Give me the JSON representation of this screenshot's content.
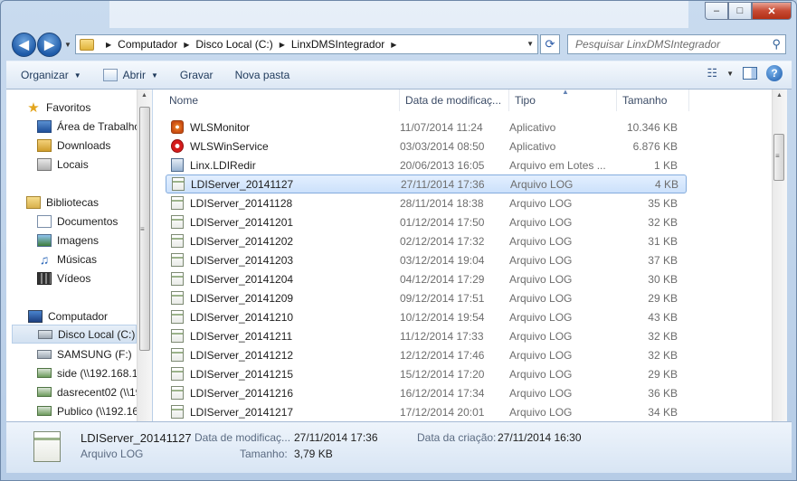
{
  "window": {
    "caption_minimize": "–",
    "caption_maximize": "□",
    "caption_close": "✕"
  },
  "address": {
    "crumbs": [
      "Computador",
      "Disco Local (C:)",
      "LinxDMSIntegrador"
    ]
  },
  "search": {
    "placeholder": "Pesquisar LinxDMSIntegrador"
  },
  "toolbar": {
    "organize": "Organizar",
    "open": "Abrir",
    "burn": "Gravar",
    "new_folder": "Nova pasta"
  },
  "nav": {
    "favorites": "Favoritos",
    "desktop": "Área de Trabalho",
    "downloads": "Downloads",
    "places": "Locais",
    "libraries": "Bibliotecas",
    "documents": "Documentos",
    "images": "Imagens",
    "music": "Músicas",
    "videos": "Vídeos",
    "computer": "Computador",
    "local_disk": "Disco Local (C:)",
    "samsung": "SAMSUNG (F:)",
    "side": "side (\\\\192.168.10",
    "dasrecent": "dasrecent02 (\\\\19",
    "publico": "Publico (\\\\192.16"
  },
  "columns": {
    "name": "Nome",
    "date": "Data de modificaç...",
    "type": "Tipo",
    "size": "Tamanho"
  },
  "files": [
    {
      "name": "WLSMonitor",
      "date": "11/07/2014 11:24",
      "type": "Aplicativo",
      "size": "10.346 KB",
      "icon": "wls-icon"
    },
    {
      "name": "WLSWinService",
      "date": "03/03/2014 08:50",
      "type": "Aplicativo",
      "size": "6.876 KB",
      "icon": "service-icon"
    },
    {
      "name": "Linx.LDIRedir",
      "date": "20/06/2013 16:05",
      "type": "Arquivo em Lotes ...",
      "size": "1 KB",
      "icon": "batch-file-icon"
    },
    {
      "name": "LDIServer_20141127",
      "date": "27/11/2014 17:36",
      "type": "Arquivo LOG",
      "size": "4 KB",
      "icon": "log-file-icon",
      "selected": true
    },
    {
      "name": "LDIServer_20141128",
      "date": "28/11/2014 18:38",
      "type": "Arquivo LOG",
      "size": "35 KB",
      "icon": "log-file-icon"
    },
    {
      "name": "LDIServer_20141201",
      "date": "01/12/2014 17:50",
      "type": "Arquivo LOG",
      "size": "32 KB",
      "icon": "log-file-icon"
    },
    {
      "name": "LDIServer_20141202",
      "date": "02/12/2014 17:32",
      "type": "Arquivo LOG",
      "size": "31 KB",
      "icon": "log-file-icon"
    },
    {
      "name": "LDIServer_20141203",
      "date": "03/12/2014 19:04",
      "type": "Arquivo LOG",
      "size": "37 KB",
      "icon": "log-file-icon"
    },
    {
      "name": "LDIServer_20141204",
      "date": "04/12/2014 17:29",
      "type": "Arquivo LOG",
      "size": "30 KB",
      "icon": "log-file-icon"
    },
    {
      "name": "LDIServer_20141209",
      "date": "09/12/2014 17:51",
      "type": "Arquivo LOG",
      "size": "29 KB",
      "icon": "log-file-icon"
    },
    {
      "name": "LDIServer_20141210",
      "date": "10/12/2014 19:54",
      "type": "Arquivo LOG",
      "size": "43 KB",
      "icon": "log-file-icon"
    },
    {
      "name": "LDIServer_20141211",
      "date": "11/12/2014 17:33",
      "type": "Arquivo LOG",
      "size": "32 KB",
      "icon": "log-file-icon"
    },
    {
      "name": "LDIServer_20141212",
      "date": "12/12/2014 17:46",
      "type": "Arquivo LOG",
      "size": "32 KB",
      "icon": "log-file-icon"
    },
    {
      "name": "LDIServer_20141215",
      "date": "15/12/2014 17:20",
      "type": "Arquivo LOG",
      "size": "29 KB",
      "icon": "log-file-icon"
    },
    {
      "name": "LDIServer_20141216",
      "date": "16/12/2014 17:34",
      "type": "Arquivo LOG",
      "size": "36 KB",
      "icon": "log-file-icon"
    },
    {
      "name": "LDIServer_20141217",
      "date": "17/12/2014 20:01",
      "type": "Arquivo LOG",
      "size": "34 KB",
      "icon": "log-file-icon"
    }
  ],
  "details": {
    "file_name": "LDIServer_20141127",
    "file_type": "Arquivo LOG",
    "modified_label": "Data de modificaç...",
    "modified_value": "27/11/2014 17:36",
    "created_label": "Data da criação:",
    "created_value": "27/11/2014 16:30",
    "size_label": "Tamanho:",
    "size_value": "3,79 KB"
  }
}
